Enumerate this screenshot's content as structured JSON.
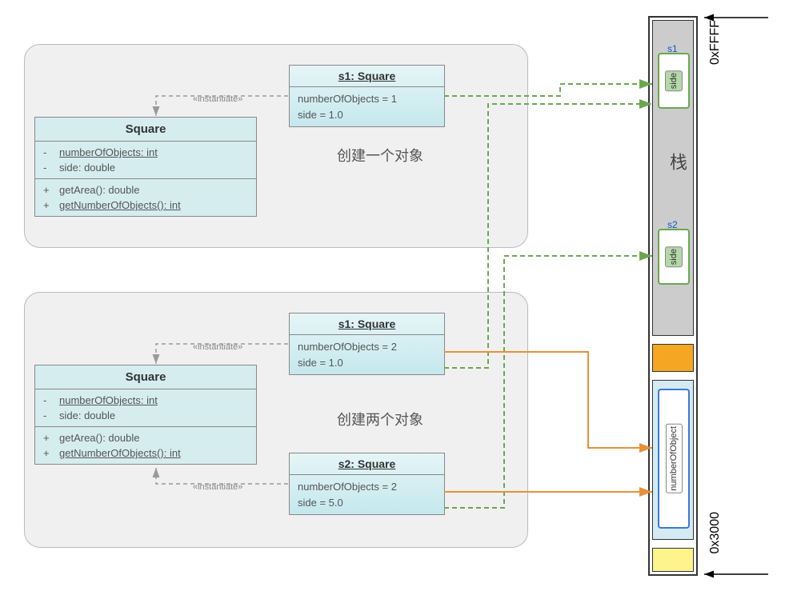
{
  "addr_high": "0xFFFF",
  "addr_low": "0x3000",
  "stack_label": "栈",
  "instantiate": "«instantiate»",
  "caption1": "创建一个对象",
  "caption2": "创建两个对象",
  "square_class": {
    "name": "Square",
    "attrs": [
      {
        "vis": "-",
        "text": "numberOfObjects: int",
        "underline": true
      },
      {
        "vis": "-",
        "text": "side: double",
        "underline": false
      }
    ],
    "ops": [
      {
        "vis": "+",
        "text": "getArea(): double",
        "underline": false
      },
      {
        "vis": "+",
        "text": "getNumberOfObjects(): int",
        "underline": true
      }
    ]
  },
  "obj_s1_a": {
    "title": "s1: Square",
    "lines": [
      "numberOfObjects = 1",
      "side = 1.0"
    ]
  },
  "obj_s1_b": {
    "title": "s1: Square",
    "lines": [
      "numberOfObjects = 2",
      "side = 1.0"
    ]
  },
  "obj_s2_b": {
    "title": "s2: Square",
    "lines": [
      "numberOfObjects = 2",
      "side = 5.0"
    ]
  },
  "mem": {
    "s1_label": "s1",
    "s2_label": "s2",
    "side": "side",
    "numberOfObject": "numberOfObject"
  }
}
